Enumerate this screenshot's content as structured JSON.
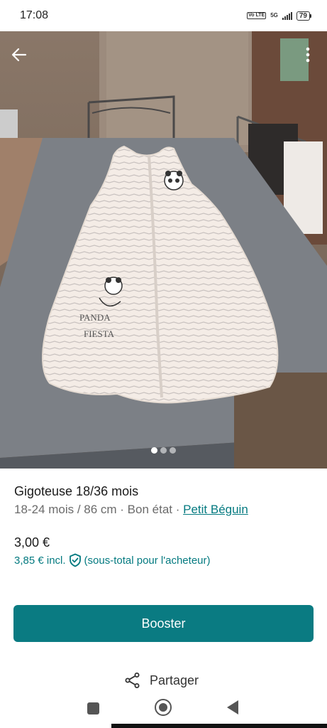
{
  "status_bar": {
    "time": "17:08",
    "volte": "Vo LTE",
    "network": "5G",
    "battery": "79"
  },
  "gallery": {
    "page_count": 3,
    "active_index": 0,
    "print_text": [
      "PANDA",
      "FIESTA"
    ]
  },
  "item": {
    "title": "Gigoteuse 18/36 mois",
    "details": "18-24 mois / 86 cm · Bon état · ",
    "brand": "Petit Béguin",
    "price": "3,00 €",
    "price_incl": "3,85 €  incl.",
    "protection_note": "(sous-total pour l'acheteur)"
  },
  "actions": {
    "booster_label": "Booster",
    "share_label": "Partager"
  },
  "colors": {
    "accent": "#0a7b82",
    "link": "#047a80"
  },
  "icons": {
    "back": "arrow-left-icon",
    "more": "more-vertical-icon",
    "shield": "shield-check-icon",
    "share": "share-icon"
  }
}
